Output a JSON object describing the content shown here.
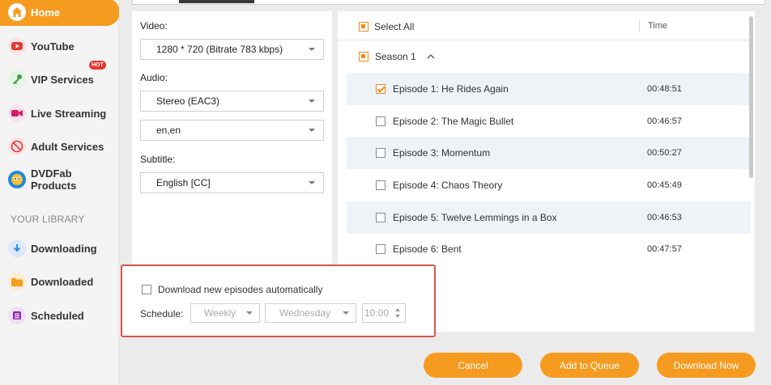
{
  "sidebar": {
    "items": [
      {
        "label": "Home",
        "icon": "home-icon",
        "color": "#ffffff"
      },
      {
        "label": "YouTube",
        "icon": "youtube-icon",
        "color": "#e53935"
      },
      {
        "label": "VIP Services",
        "icon": "key-icon",
        "color": "#43a047",
        "badge": "HOT"
      },
      {
        "label": "Live Streaming",
        "icon": "camera-icon",
        "color": "#d81b60"
      },
      {
        "label": "Adult Services",
        "icon": "no-adult-icon",
        "color": "#e53935"
      },
      {
        "label": "DVDFab Products",
        "icon": "dvdfab-logo-icon",
        "color": "#1e88e5"
      }
    ],
    "library_title": "YOUR LIBRARY",
    "library": [
      {
        "label": "Downloading",
        "icon": "download-arrow-icon",
        "color": "#1e88e5"
      },
      {
        "label": "Downloaded",
        "icon": "folder-icon",
        "color": "#f59b20"
      },
      {
        "label": "Scheduled",
        "icon": "list-icon",
        "color": "#8e24aa"
      }
    ]
  },
  "options": {
    "video_label": "Video:",
    "video_value": "1280 * 720 (Bitrate 783 kbps)",
    "audio_label": "Audio:",
    "audio_value": "Stereo (EAC3)",
    "audio_lang_value": "en,en",
    "subtitle_label": "Subtitle:",
    "subtitle_value": "English [CC]"
  },
  "episodes": {
    "select_all": "Select All",
    "time_header": "Time",
    "season_label": "Season 1",
    "rows": [
      {
        "title": "Episode 1: He Rides Again",
        "time": "00:48:51",
        "checked": true
      },
      {
        "title": "Episode 2: The Magic Bullet",
        "time": "00:46:57",
        "checked": false
      },
      {
        "title": "Episode 3: Momentum",
        "time": "00:50:27",
        "checked": false
      },
      {
        "title": "Episode 4: Chaos Theory",
        "time": "00:45:49",
        "checked": false
      },
      {
        "title": "Episode 5: Twelve Lemmings in a Box",
        "time": "00:46:53",
        "checked": false
      },
      {
        "title": "Episode 6: Bent",
        "time": "00:47:57",
        "checked": false
      }
    ]
  },
  "schedule": {
    "auto_download_label": "Download new episodes automatically",
    "schedule_label": "Schedule:",
    "frequency": "Weekly",
    "day": "Wednesday",
    "time": "10:00"
  },
  "buttons": {
    "cancel": "Cancel",
    "add_to_queue": "Add to Queue",
    "download_now": "Download Now"
  },
  "colors": {
    "accent": "#f59b20",
    "highlight_border": "#d9534f",
    "row_shade": "#eef3f8"
  }
}
